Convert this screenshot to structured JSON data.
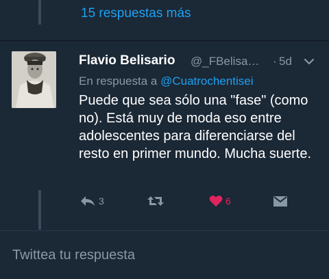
{
  "thread": {
    "more_replies": "15 respuestas más"
  },
  "tweet": {
    "author_name": "Flavio Belisario",
    "author_handle": "@_FBelisa…",
    "separator": "·",
    "time": "5d",
    "reply_prefix": "En respuesta a",
    "reply_to": "@Cuatrochentisei",
    "text": "Puede que sea sólo una \"fase\" (como no). Está muy de moda eso entre adolescentes para diferenciarse del resto en primer mundo. Mucha suerte.",
    "reply_count": "3",
    "retweet_count": "",
    "like_count": "6",
    "liked": true
  },
  "compose": {
    "placeholder": "Twittea tu respuesta"
  },
  "colors": {
    "background": "#1b2836",
    "accent": "#1da1f2",
    "muted": "#8899a6",
    "like": "#e0245e"
  },
  "icons": [
    "reply-icon",
    "retweet-icon",
    "heart-icon",
    "direct-message-icon",
    "chevron-down-icon"
  ]
}
